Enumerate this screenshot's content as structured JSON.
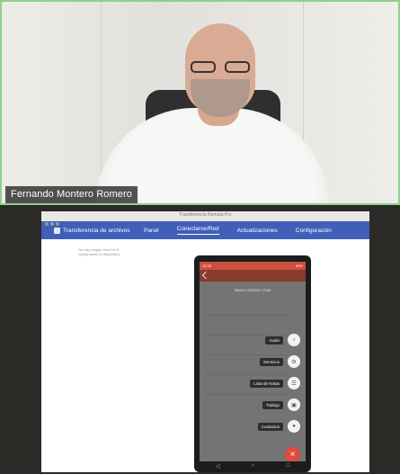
{
  "video": {
    "participant_name": "Fernando Montero Romero"
  },
  "shared_app": {
    "window_title": "Transferencia Remota Pro",
    "brand": "Transferencia de archivos",
    "tabs": [
      {
        "label": "Panel",
        "active": false
      },
      {
        "label": "Conectarse/Red",
        "active": true
      },
      {
        "label": "Actualizaciones",
        "active": false
      },
      {
        "label": "Configuración",
        "active": false
      }
    ],
    "hint": "No hay ningún móvil ni el configurador el dispositivo",
    "accent": "#3f5fb8"
  },
  "phone": {
    "status_left": "12:30",
    "status_right": "89%",
    "screen_title": "Nuevo destino / Nas",
    "fab_items": [
      {
        "label": "Audio",
        "icon": "music-icon"
      },
      {
        "label": "Servicios",
        "icon": "gear-icon"
      },
      {
        "label": "Lista de Notas",
        "icon": "list-icon"
      },
      {
        "label": "Trabajo",
        "icon": "briefcase-icon"
      },
      {
        "label": "Contactos",
        "icon": "person-icon"
      }
    ],
    "fab_main_icon": "close-icon",
    "accent": "#e24a3d"
  }
}
